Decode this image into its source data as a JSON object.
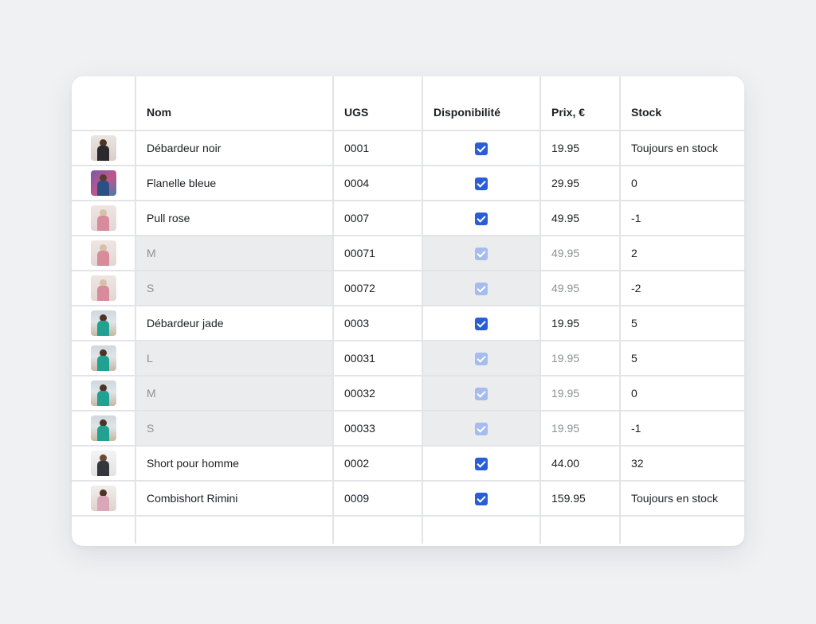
{
  "columns": {
    "name": "Nom",
    "sku": "UGS",
    "availability": "Disponibilité",
    "price": "Prix, €",
    "stock": "Stock"
  },
  "rows": [
    {
      "thumbnail": "black-tank-top-photo",
      "name": "Débardeur noir",
      "sku": "0001",
      "available": true,
      "price": "19.95",
      "stock": "Toujours en stock",
      "variant": false
    },
    {
      "thumbnail": "blue-flannel-photo",
      "name": "Flanelle bleue",
      "sku": "0004",
      "available": true,
      "price": "29.95",
      "stock": "0",
      "variant": false
    },
    {
      "thumbnail": "pink-sweater-photo",
      "name": "Pull rose",
      "sku": "0007",
      "available": true,
      "price": "49.95",
      "stock": "-1",
      "variant": false
    },
    {
      "thumbnail": "pink-sweater-photo",
      "name": "M",
      "sku": "00071",
      "available": true,
      "price": "49.95",
      "stock": "2",
      "variant": true
    },
    {
      "thumbnail": "pink-sweater-photo",
      "name": "S",
      "sku": "00072",
      "available": true,
      "price": "49.95",
      "stock": "-2",
      "variant": true
    },
    {
      "thumbnail": "jade-tank-top-photo",
      "name": "Débardeur jade",
      "sku": "0003",
      "available": true,
      "price": "19.95",
      "stock": "5",
      "variant": false
    },
    {
      "thumbnail": "jade-tank-top-photo",
      "name": "L",
      "sku": "00031",
      "available": true,
      "price": "19.95",
      "stock": "5",
      "variant": true
    },
    {
      "thumbnail": "jade-tank-top-photo",
      "name": "M",
      "sku": "00032",
      "available": true,
      "price": "19.95",
      "stock": "0",
      "variant": true
    },
    {
      "thumbnail": "jade-tank-top-photo",
      "name": "S",
      "sku": "00033",
      "available": true,
      "price": "19.95",
      "stock": "-1",
      "variant": true
    },
    {
      "thumbnail": "mens-shorts-photo",
      "name": "Short pour homme",
      "sku": "0002",
      "available": true,
      "price": "44.00",
      "stock": "32",
      "variant": false
    },
    {
      "thumbnail": "rimini-romper-photo",
      "name": "Combishort Rimini",
      "sku": "0009",
      "available": true,
      "price": "159.95",
      "stock": "Toujours en stock",
      "variant": false
    }
  ],
  "colors": {
    "background": "#f0f1f3",
    "card": "#ffffff",
    "grid_line": "#e3e4e7",
    "variant_cell": "#ebecee",
    "checkbox": "#2a5ed6",
    "checkbox_muted": "#a6bcee",
    "muted_text": "#8d9096"
  }
}
